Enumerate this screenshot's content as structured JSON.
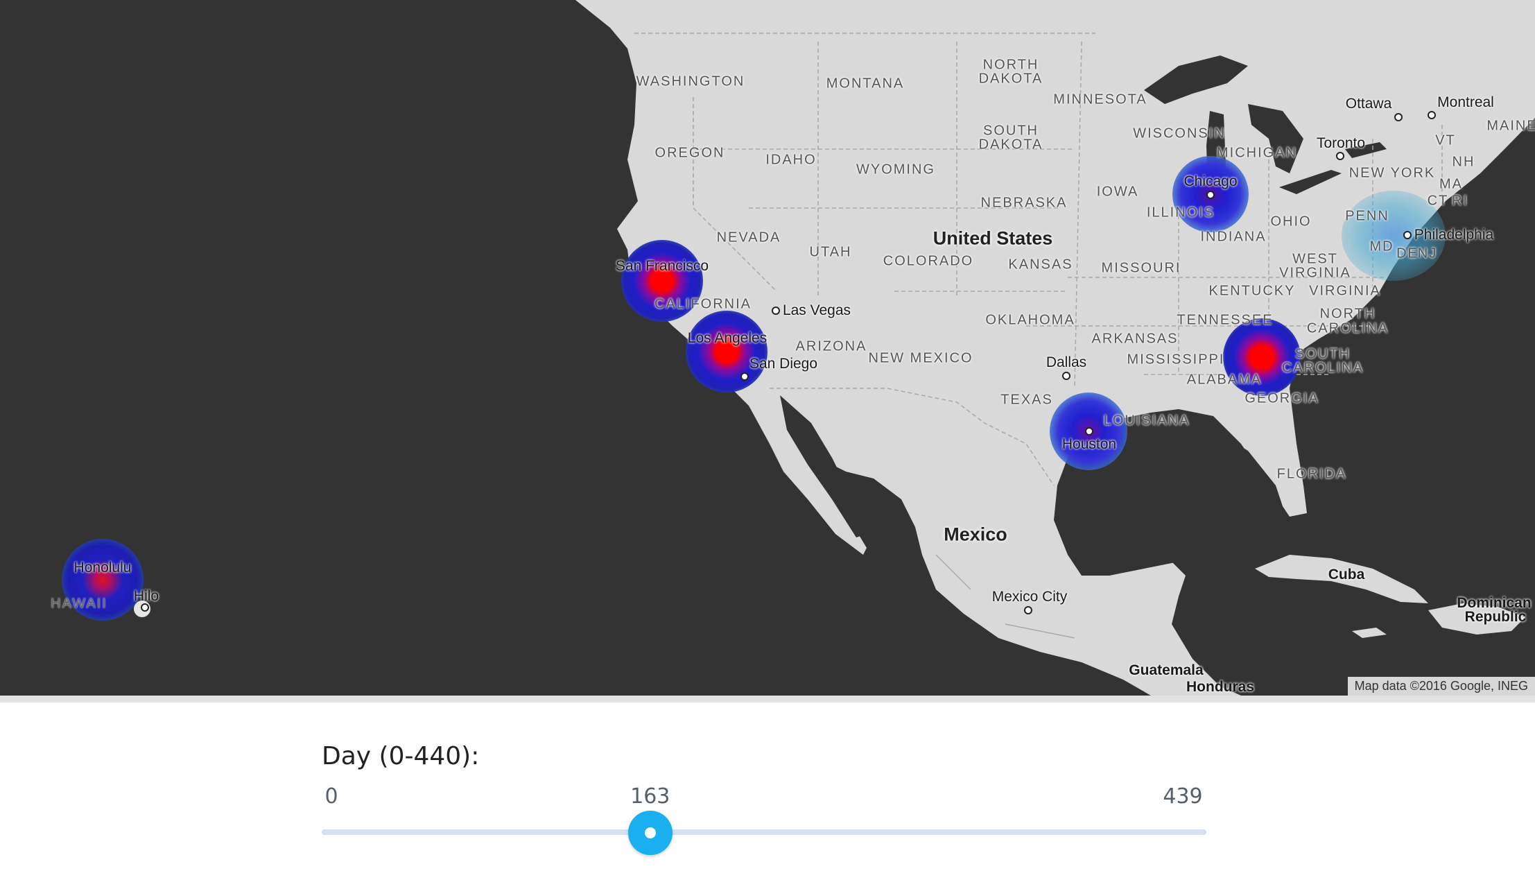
{
  "map": {
    "attribution": "Map data ©2016 Google, INEG",
    "countries": {
      "us": "United States",
      "mexico": "Mexico",
      "cuba": "Cuba",
      "dominican": "Dominican",
      "republic": "Republic",
      "guatemala": "Guatemala",
      "honduras": "Honduras"
    },
    "states": {
      "washington": "WASHINGTON",
      "montana": "MONTANA",
      "north": "NORTH",
      "dakota1": "DAKOTA",
      "minnesota": "MINNESOTA",
      "south": "SOUTH",
      "dakota2": "DAKOTA",
      "oregon": "OREGON",
      "idaho": "IDAHO",
      "wyoming": "WYOMING",
      "nebraska": "NEBRASKA",
      "iowa": "IOWA",
      "wisconsin": "WISCONSIN",
      "michigan": "MICHIGAN",
      "illinois": "ILLINOIS",
      "indiana": "INDIANA",
      "ohio": "OHIO",
      "penn": "PENN",
      "newyork": "NEW YORK",
      "nevada": "NEVADA",
      "utah": "UTAH",
      "colorado": "COLORADO",
      "kansas": "KANSAS",
      "missouri": "MISSOURI",
      "california": "CALIFORNIA",
      "westvirginia1": "WEST",
      "westvirginia2": "VIRGINIA",
      "virginia": "VIRGINIA",
      "kentucky": "KENTUCKY",
      "tennessee": "TENNESSEE",
      "northcarolina1": "NORTH",
      "northcarolina2": "CAROLINA",
      "oklahoma": "OKLAHOMA",
      "arkansas": "ARKANSAS",
      "arizona": "ARIZONA",
      "newmexico": "NEW MEXICO",
      "mississippi": "MISSISSIPPI",
      "southcarolina1": "SOUTH",
      "southcarolina2": "CAROLINA",
      "alabama": "ALABAMA",
      "georgia": "GEORGIA",
      "texas": "TEXAS",
      "louisiana": "LOUISIANA",
      "florida": "FLORIDA",
      "maine": "MAINE",
      "vt": "VT",
      "nh": "NH",
      "ma": "MA",
      "ct": "CT",
      "ri": "RI",
      "md": "MD",
      "de": "DE",
      "nj": "NJ",
      "hawaii": "HAWAII"
    },
    "cities": {
      "ottawa": "Ottawa",
      "montreal": "Montreal",
      "toronto": "Toronto",
      "chicago": "Chicago",
      "philadelphia": "Philadelphia",
      "sanfrancisco": "San Francisco",
      "lasvegas": "Las Vegas",
      "losangeles": "Los Angeles",
      "sandiego": "San Diego",
      "dallas": "Dallas",
      "houston": "Houston",
      "mexicocity": "Mexico City",
      "honolulu": "Honolulu",
      "hilo": "Hilo"
    },
    "heatmap_colors": [
      "#ff0000",
      "#2020d0",
      "#3ab0c0"
    ]
  },
  "slider": {
    "title": "Day (0-440):",
    "min_label": "0",
    "max_label": "439",
    "value_label": "163",
    "min": 0,
    "max": 439,
    "value": 163,
    "accent_color": "#1ab0ef"
  }
}
